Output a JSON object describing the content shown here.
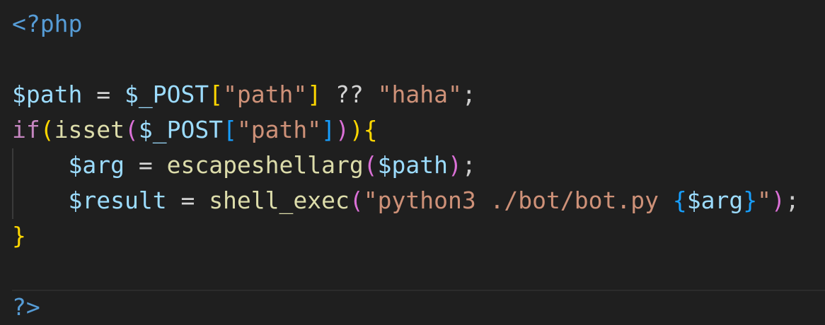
{
  "editor": {
    "lines": [
      "<?php",
      "",
      "$path = $_POST[\"path\"] ?? \"haha\";",
      "if(isset($_POST[\"path\"])){",
      "    $arg = escapeshellarg($path);",
      "    $result = shell_exec(\"python3 ./bot/bot.py {$arg}\");",
      "}",
      "",
      "?>"
    ],
    "tokens": {
      "open_tag": "<?php",
      "close_tag": "?>",
      "var_path": "$path",
      "var_post": "$_POST",
      "var_arg": "$arg",
      "var_result": "$result",
      "var_arg_interp": "$arg",
      "kw_if": "if",
      "fn_isset": "isset",
      "fn_escapeshellarg": "escapeshellarg",
      "fn_shell_exec": "shell_exec",
      "str_path": "\"path\"",
      "str_haha": "\"haha\"",
      "str_cmd_start": "\"python3 ./bot/bot.py ",
      "str_cmd_end": "\"",
      "op_assign": "=",
      "op_coalesce": "??"
    },
    "colors": {
      "background": "#1f1f1f",
      "keyword_tag": "#569cd6",
      "variable": "#9cdcfe",
      "string": "#ce9178",
      "control": "#c586c0",
      "function": "#dcdcaa",
      "bracket_level1": "#ffd700",
      "bracket_level2": "#da70d6",
      "bracket_level3": "#179fff"
    }
  }
}
